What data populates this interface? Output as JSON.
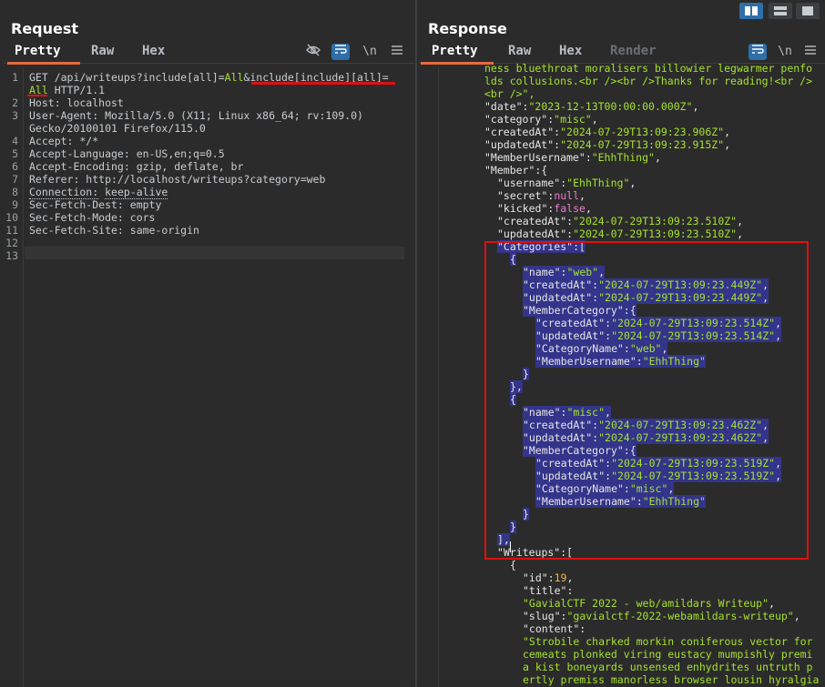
{
  "request": {
    "title": "Request",
    "tabs": [
      "Pretty",
      "Raw",
      "Hex"
    ],
    "line_numbers": [
      "1",
      "2",
      "3",
      "4",
      "5",
      "6",
      "7",
      "8",
      "9",
      "10",
      "11",
      "12",
      "13"
    ],
    "lines": {
      "l1a": "GET /api/writeups?include[all]=",
      "l1b": "All",
      "l1c": "&include[include][all]=",
      "l1d": "All",
      "l1e": " HTTP/1.1",
      "host": "Host: localhost",
      "ua1": "User-Agent: Mozilla/5.0 (X11; Linux x86_64; rv:109.0)",
      "ua2": "Gecko/20100101 Firefox/115.0",
      "accept": "Accept: */*",
      "lang": "Accept-Language: en-US,en;q=0.5",
      "enc": "Accept-Encoding: gzip, deflate, br",
      "ref": "Referer: http://localhost/writeups?category=web",
      "conn_key": "Connection:",
      "conn_val": "keep-alive",
      "dest": "Sec-Fetch-Dest: empty",
      "mode": "Sec-Fetch-Mode: cors",
      "site": "Sec-Fetch-Site: same-origin"
    }
  },
  "response": {
    "title": "Response",
    "tabs": [
      "Pretty",
      "Raw",
      "Hex",
      "Render"
    ],
    "json_lines": [
      {
        "indent": 0,
        "parts": [
          [
            "str",
            "ness bluethroat moralisers billowier legwarmer penfo"
          ]
        ]
      },
      {
        "indent": 0,
        "parts": [
          [
            "str",
            "lds collusions.<br /><br />Thanks for reading!<br />"
          ]
        ]
      },
      {
        "indent": 0,
        "parts": [
          [
            "str",
            "<br />\","
          ]
        ]
      },
      {
        "indent": 0,
        "parts": [
          [
            "key",
            "\"date\":"
          ],
          [
            "str",
            "\"2023-12-13T00:00:00.000Z\""
          ],
          [
            "key",
            ","
          ]
        ]
      },
      {
        "indent": 0,
        "parts": [
          [
            "key",
            "\"category\":"
          ],
          [
            "str",
            "\"misc\""
          ],
          [
            "key",
            ","
          ]
        ]
      },
      {
        "indent": 0,
        "parts": [
          [
            "key",
            "\"createdAt\":"
          ],
          [
            "str",
            "\"2024-07-29T13:09:23.906Z\""
          ],
          [
            "key",
            ","
          ]
        ]
      },
      {
        "indent": 0,
        "parts": [
          [
            "key",
            "\"updatedAt\":"
          ],
          [
            "str",
            "\"2024-07-29T13:09:23.915Z\""
          ],
          [
            "key",
            ","
          ]
        ]
      },
      {
        "indent": 0,
        "parts": [
          [
            "key",
            "\"MemberUsername\":"
          ],
          [
            "str",
            "\"EhhThing\""
          ],
          [
            "key",
            ","
          ]
        ]
      },
      {
        "indent": 0,
        "parts": [
          [
            "key",
            "\"Member\":{"
          ]
        ]
      },
      {
        "indent": 1,
        "parts": [
          [
            "key",
            "\"username\":"
          ],
          [
            "str",
            "\"EhhThing\""
          ],
          [
            "key",
            ","
          ]
        ]
      },
      {
        "indent": 1,
        "parts": [
          [
            "key",
            "\"secret\":"
          ],
          [
            "kw",
            "null"
          ],
          [
            "key",
            ","
          ]
        ]
      },
      {
        "indent": 1,
        "parts": [
          [
            "key",
            "\"kicked\":"
          ],
          [
            "kw",
            "false"
          ],
          [
            "key",
            ","
          ]
        ]
      },
      {
        "indent": 1,
        "parts": [
          [
            "key",
            "\"createdAt\":"
          ],
          [
            "str",
            "\"2024-07-29T13:09:23.510Z\""
          ],
          [
            "key",
            ","
          ]
        ]
      },
      {
        "indent": 1,
        "parts": [
          [
            "key",
            "\"updatedAt\":"
          ],
          [
            "str",
            "\"2024-07-29T13:09:23.510Z\""
          ],
          [
            "key",
            ","
          ]
        ]
      },
      {
        "indent": 1,
        "sel": true,
        "parts": [
          [
            "key",
            "\"Categories\":["
          ]
        ]
      },
      {
        "indent": 2,
        "sel": true,
        "parts": [
          [
            "key",
            "{"
          ]
        ]
      },
      {
        "indent": 3,
        "sel": true,
        "parts": [
          [
            "key",
            "\"name\":"
          ],
          [
            "str",
            "\"web\""
          ],
          [
            "key",
            ","
          ]
        ]
      },
      {
        "indent": 3,
        "sel": true,
        "parts": [
          [
            "key",
            "\"createdAt\":"
          ],
          [
            "str",
            "\"2024-07-29T13:09:23.449Z\""
          ],
          [
            "key",
            ","
          ]
        ]
      },
      {
        "indent": 3,
        "sel": true,
        "parts": [
          [
            "key",
            "\"updatedAt\":"
          ],
          [
            "str",
            "\"2024-07-29T13:09:23.449Z\""
          ],
          [
            "key",
            ","
          ]
        ]
      },
      {
        "indent": 3,
        "sel": true,
        "parts": [
          [
            "key",
            "\"MemberCategory\":{"
          ]
        ]
      },
      {
        "indent": 4,
        "sel": true,
        "parts": [
          [
            "key",
            "\"createdAt\":"
          ],
          [
            "str",
            "\"2024-07-29T13:09:23.514Z\""
          ],
          [
            "key",
            ","
          ]
        ]
      },
      {
        "indent": 4,
        "sel": true,
        "parts": [
          [
            "key",
            "\"updatedAt\":"
          ],
          [
            "str",
            "\"2024-07-29T13:09:23.514Z\""
          ],
          [
            "key",
            ","
          ]
        ]
      },
      {
        "indent": 4,
        "sel": true,
        "parts": [
          [
            "key",
            "\"CategoryName\":"
          ],
          [
            "str",
            "\"web\""
          ],
          [
            "key",
            ","
          ]
        ]
      },
      {
        "indent": 4,
        "sel": true,
        "parts": [
          [
            "key",
            "\"MemberUsername\":"
          ],
          [
            "str",
            "\"EhhThing\""
          ]
        ]
      },
      {
        "indent": 3,
        "sel": true,
        "parts": [
          [
            "key",
            "}"
          ]
        ]
      },
      {
        "indent": 2,
        "sel": true,
        "parts": [
          [
            "key",
            "},"
          ]
        ]
      },
      {
        "indent": 2,
        "sel": true,
        "parts": [
          [
            "key",
            "{"
          ]
        ]
      },
      {
        "indent": 3,
        "sel": true,
        "parts": [
          [
            "key",
            "\"name\":"
          ],
          [
            "str",
            "\"misc\""
          ],
          [
            "key",
            ","
          ]
        ]
      },
      {
        "indent": 3,
        "sel": true,
        "parts": [
          [
            "key",
            "\"createdAt\":"
          ],
          [
            "str",
            "\"2024-07-29T13:09:23.462Z\""
          ],
          [
            "key",
            ","
          ]
        ]
      },
      {
        "indent": 3,
        "sel": true,
        "parts": [
          [
            "key",
            "\"updatedAt\":"
          ],
          [
            "str",
            "\"2024-07-29T13:09:23.462Z\""
          ],
          [
            "key",
            ","
          ]
        ]
      },
      {
        "indent": 3,
        "sel": true,
        "parts": [
          [
            "key",
            "\"MemberCategory\":{"
          ]
        ]
      },
      {
        "indent": 4,
        "sel": true,
        "parts": [
          [
            "key",
            "\"createdAt\":"
          ],
          [
            "str",
            "\"2024-07-29T13:09:23.519Z\""
          ],
          [
            "key",
            ","
          ]
        ]
      },
      {
        "indent": 4,
        "sel": true,
        "parts": [
          [
            "key",
            "\"updatedAt\":"
          ],
          [
            "str",
            "\"2024-07-29T13:09:23.519Z\""
          ],
          [
            "key",
            ","
          ]
        ]
      },
      {
        "indent": 4,
        "sel": true,
        "parts": [
          [
            "key",
            "\"CategoryName\":"
          ],
          [
            "str",
            "\"misc\""
          ],
          [
            "key",
            ","
          ]
        ]
      },
      {
        "indent": 4,
        "sel": true,
        "parts": [
          [
            "key",
            "\"MemberUsername\":"
          ],
          [
            "str",
            "\"EhhThing\""
          ]
        ]
      },
      {
        "indent": 3,
        "sel": true,
        "parts": [
          [
            "key",
            "}"
          ]
        ]
      },
      {
        "indent": 2,
        "sel": true,
        "parts": [
          [
            "key",
            "}"
          ]
        ]
      },
      {
        "indent": 1,
        "sel": true,
        "parts": [
          [
            "key",
            "],"
          ]
        ]
      },
      {
        "indent": 1,
        "parts": [
          [
            "key",
            "\"Writeups\":["
          ]
        ]
      },
      {
        "indent": 2,
        "parts": [
          [
            "key",
            "{"
          ]
        ]
      },
      {
        "indent": 3,
        "parts": [
          [
            "key",
            "\"id\":"
          ],
          [
            "num",
            "19"
          ],
          [
            "key",
            ","
          ]
        ]
      },
      {
        "indent": 3,
        "parts": [
          [
            "key",
            "\"title\":"
          ]
        ]
      },
      {
        "indent": 3,
        "parts": [
          [
            "str",
            "\"GavialCTF 2022 - web/amildars Writeup\""
          ],
          [
            "key",
            ","
          ]
        ]
      },
      {
        "indent": 3,
        "parts": [
          [
            "key",
            "\"slug\":"
          ],
          [
            "str",
            "\"gavialctf-2022-webamildars-writeup\""
          ],
          [
            "key",
            ","
          ]
        ]
      },
      {
        "indent": 3,
        "parts": [
          [
            "key",
            "\"content\":"
          ]
        ]
      },
      {
        "indent": 3,
        "parts": [
          [
            "str",
            "\"Strobile charked morkin coniferous vector for"
          ]
        ]
      },
      {
        "indent": 3,
        "parts": [
          [
            "str",
            "cemeats plonked viring eustacy mumpishly premi"
          ]
        ]
      },
      {
        "indent": 3,
        "parts": [
          [
            "str",
            "a kist boneyards unsensed enhydrites untruth p"
          ]
        ]
      },
      {
        "indent": 3,
        "parts": [
          [
            "str",
            "ertly premiss manorless browser lousin hyralgia"
          ]
        ]
      }
    ]
  },
  "colors": {
    "accent": "#e8693f",
    "highlight": "#e01010",
    "selection": "#33348a",
    "toggle_on": "#2f6ea8"
  },
  "icons": [
    "layout-split-icon",
    "layout-horizontal-icon",
    "layout-single-icon",
    "eye-off-icon",
    "wrap-icon",
    "newline-icon",
    "hamburger-menu-icon"
  ]
}
